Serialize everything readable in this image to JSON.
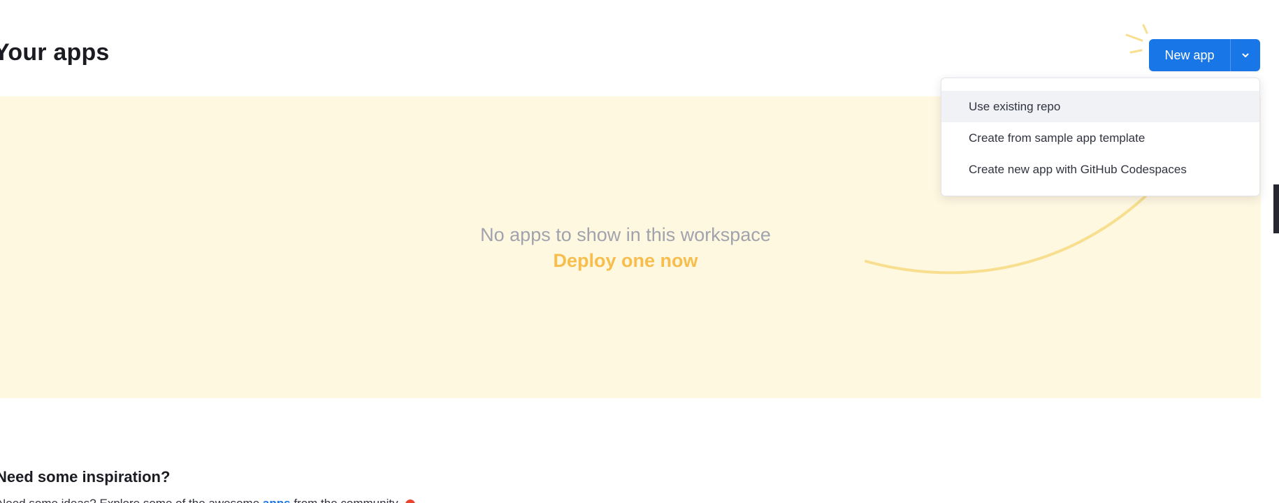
{
  "header": {
    "title": "Your apps"
  },
  "new_app": {
    "label": "New app",
    "caret_icon": "chevron-down-icon",
    "color": "#1976e6"
  },
  "dropdown": {
    "items": [
      {
        "label": "Use existing repo",
        "active": true
      },
      {
        "label": "Create from sample app template",
        "active": false
      },
      {
        "label": "Create new app with GitHub Codespaces",
        "active": false
      }
    ]
  },
  "empty_state": {
    "message": "No apps to show in this workspace",
    "cta": "Deploy one now",
    "cta_color": "#f7bd4d",
    "panel_color": "#fff8e1"
  },
  "inspiration": {
    "title": "Need some inspiration?",
    "text_before": "Need some ideas? Explore some of the awesome",
    "link": "apps",
    "text_after": "from the community"
  }
}
